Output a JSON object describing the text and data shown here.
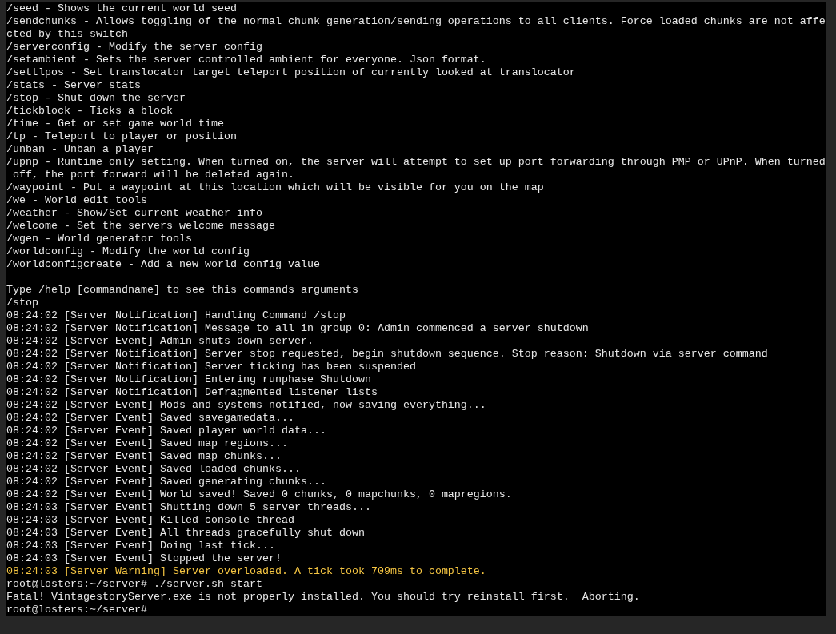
{
  "terminal": {
    "lines": [
      {
        "kind": "output",
        "text": "/seed - Shows the current world seed"
      },
      {
        "kind": "output",
        "text": "/sendchunks - Allows toggling of the normal chunk generation/sending operations to all clients. Force loaded chunks are not affe"
      },
      {
        "kind": "output",
        "text": "cted by this switch"
      },
      {
        "kind": "output",
        "text": "/serverconfig - Modify the server config"
      },
      {
        "kind": "output",
        "text": "/setambient - Sets the server controlled ambient for everyone. Json format."
      },
      {
        "kind": "output",
        "text": "/settlpos - Set translocator target teleport position of currently looked at translocator"
      },
      {
        "kind": "output",
        "text": "/stats - Server stats"
      },
      {
        "kind": "output",
        "text": "/stop - Shut down the server"
      },
      {
        "kind": "output",
        "text": "/tickblock - Ticks a block"
      },
      {
        "kind": "output",
        "text": "/time - Get or set game world time"
      },
      {
        "kind": "output",
        "text": "/tp - Teleport to player or position"
      },
      {
        "kind": "output",
        "text": "/unban - Unban a player"
      },
      {
        "kind": "output",
        "text": "/upnp - Runtime only setting. When turned on, the server will attempt to set up port forwarding through PMP or UPnP. When turned"
      },
      {
        "kind": "output",
        "text": " off, the port forward will be deleted again."
      },
      {
        "kind": "output",
        "text": "/waypoint - Put a waypoint at this location which will be visible for you on the map"
      },
      {
        "kind": "output",
        "text": "/we - World edit tools"
      },
      {
        "kind": "output",
        "text": "/weather - Show/Set current weather info"
      },
      {
        "kind": "output",
        "text": "/welcome - Set the servers welcome message"
      },
      {
        "kind": "output",
        "text": "/wgen - World generator tools"
      },
      {
        "kind": "output",
        "text": "/worldconfig - Modify the world config"
      },
      {
        "kind": "output",
        "text": "/worldconfigcreate - Add a new world config value"
      },
      {
        "kind": "blank"
      },
      {
        "kind": "output",
        "text": "Type /help [commandname] to see this commands arguments"
      },
      {
        "kind": "output",
        "text": "/stop"
      },
      {
        "kind": "output",
        "text": "08:24:02 [Server Notification] Handling Command /stop"
      },
      {
        "kind": "output",
        "text": "08:24:02 [Server Notification] Message to all in group 0: Admin commenced a server shutdown"
      },
      {
        "kind": "output",
        "text": "08:24:02 [Server Event] Admin shuts down server."
      },
      {
        "kind": "output",
        "text": "08:24:02 [Server Notification] Server stop requested, begin shutdown sequence. Stop reason: Shutdown via server command"
      },
      {
        "kind": "output",
        "text": "08:24:02 [Server Notification] Server ticking has been suspended"
      },
      {
        "kind": "output",
        "text": "08:24:02 [Server Notification] Entering runphase Shutdown"
      },
      {
        "kind": "output",
        "text": "08:24:02 [Server Notification] Defragmented listener lists"
      },
      {
        "kind": "output",
        "text": "08:24:02 [Server Event] Mods and systems notified, now saving everything..."
      },
      {
        "kind": "output",
        "text": "08:24:02 [Server Event] Saved savegamedata..."
      },
      {
        "kind": "output",
        "text": "08:24:02 [Server Event] Saved player world data..."
      },
      {
        "kind": "output",
        "text": "08:24:02 [Server Event] Saved map regions..."
      },
      {
        "kind": "output",
        "text": "08:24:02 [Server Event] Saved map chunks..."
      },
      {
        "kind": "output",
        "text": "08:24:02 [Server Event] Saved loaded chunks..."
      },
      {
        "kind": "output",
        "text": "08:24:02 [Server Event] Saved generating chunks..."
      },
      {
        "kind": "output",
        "text": "08:24:02 [Server Event] World saved! Saved 0 chunks, 0 mapchunks, 0 mapregions."
      },
      {
        "kind": "output",
        "text": "08:24:03 [Server Event] Shutting down 5 server threads..."
      },
      {
        "kind": "output",
        "text": "08:24:03 [Server Event] Killed console thread"
      },
      {
        "kind": "output",
        "text": "08:24:03 [Server Event] All threads gracefully shut down"
      },
      {
        "kind": "output",
        "text": "08:24:03 [Server Event] Doing last tick..."
      },
      {
        "kind": "output",
        "text": "08:24:03 [Server Event] Stopped the server!"
      },
      {
        "kind": "warning",
        "text": "08:24:03 [Server Warning] Server overloaded. A tick took 709ms to complete."
      },
      {
        "kind": "output",
        "text": "root@losters:~/server# ./server.sh start"
      },
      {
        "kind": "output",
        "text": "Fatal! VintagestoryServer.exe is not properly installed. You should try reinstall first.  Aborting."
      },
      {
        "kind": "prompt",
        "text": "root@losters:~/server#"
      }
    ]
  }
}
